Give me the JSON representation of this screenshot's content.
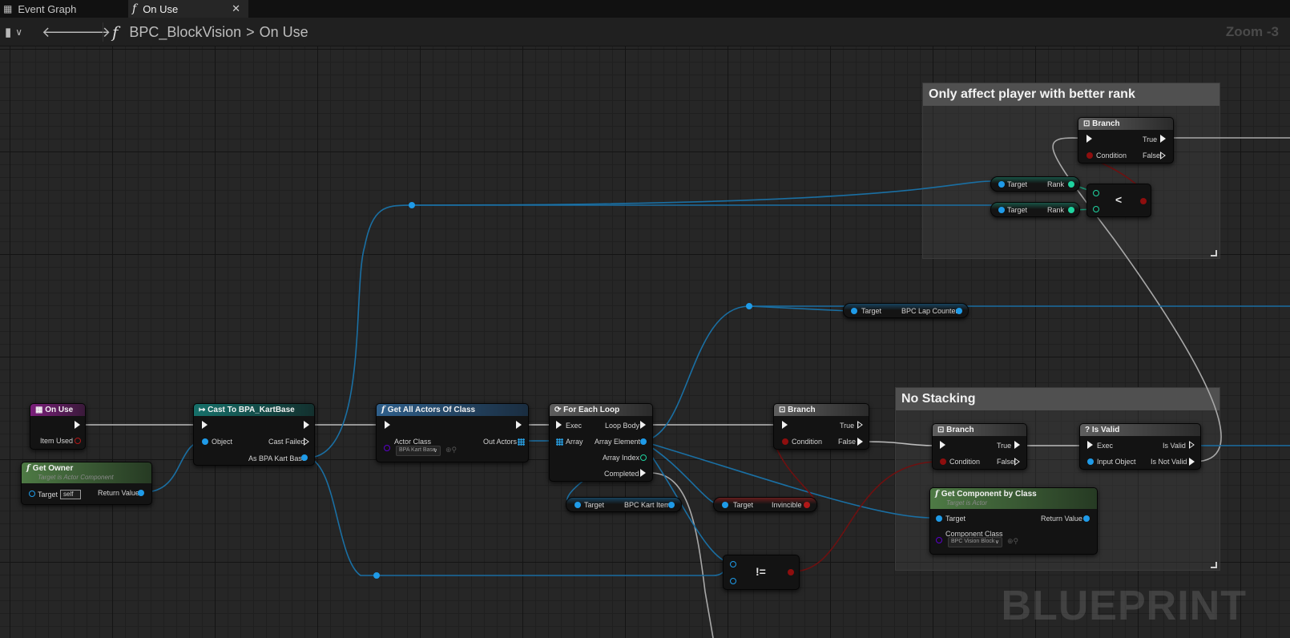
{
  "tabs": [
    {
      "label": "Event Graph",
      "active": false
    },
    {
      "label": "On Use",
      "active": true
    }
  ],
  "toolbar": {
    "breadcrumb_root": "BPC_BlockVision",
    "breadcrumb_separator": ">",
    "breadcrumb_current": "On Use",
    "zoom": "Zoom -3"
  },
  "comments": {
    "rank": "Only affect player with better rank",
    "stacking": "No Stacking"
  },
  "nodes": {
    "on_use": {
      "title": "On Use",
      "item_used": "Item Used"
    },
    "get_owner": {
      "title": "Get Owner",
      "subtitle": "Target is Actor Component",
      "target": "Target",
      "target_value": "self",
      "return_value": "Return Value"
    },
    "cast": {
      "title": "Cast To BPA_KartBase",
      "object": "Object",
      "cast_failed": "Cast Failed",
      "as_base": "As BPA Kart Base"
    },
    "get_all": {
      "title": "Get All Actors Of Class",
      "actor_class": "Actor Class",
      "class_value": "BPA Kart Base",
      "out_actors": "Out Actors"
    },
    "for_each": {
      "title": "For Each Loop",
      "exec": "Exec",
      "array": "Array",
      "loop_body": "Loop Body",
      "array_element": "Array Element",
      "array_index": "Array Index",
      "completed": "Completed"
    },
    "branch_main": {
      "title": "Branch",
      "condition": "Condition",
      "true": "True",
      "false": "False"
    },
    "branch_stack": {
      "title": "Branch",
      "condition": "Condition",
      "true": "True",
      "false": "False"
    },
    "is_valid": {
      "title": "Is Valid",
      "exec": "Exec",
      "input_object": "Input Object",
      "is_valid": "Is Valid",
      "is_not_valid": "Is Not Valid"
    },
    "get_component": {
      "title": "Get Component by Class",
      "subtitle": "Target is Actor",
      "target": "Target",
      "component_class": "Component Class",
      "class_value": "BPC Vision Block",
      "return_value": "Return Value"
    },
    "branch_rank": {
      "title": "Branch",
      "condition": "Condition",
      "true": "True",
      "false": "False"
    },
    "rank_top": {
      "target": "Target",
      "out": "Rank"
    },
    "rank_bottom": {
      "target": "Target",
      "out": "Rank"
    },
    "less_than": {
      "symbol": "<"
    },
    "lap_counter": {
      "target": "Target",
      "out": "BPC Lap Counter"
    },
    "kart_item": {
      "target": "Target",
      "out": "BPC Kart Item"
    },
    "invincible": {
      "target": "Target",
      "out": "Invincible"
    },
    "not_equal": {
      "symbol": "!="
    }
  },
  "colors": {
    "exec": "#f0f0f0",
    "object_pin": "#1f9be8",
    "bool_pin": "#8e0e0e",
    "int_pin": "#1fd4a0",
    "class_pin": "#5a00c8",
    "event_header": "#7a1f7a",
    "cast_header": "#16706a",
    "function_header": "#2f5f8a",
    "pure_header": "#4e7a45",
    "flow_header": "#5e5e5e"
  },
  "icons": [
    "graph-icon",
    "function-icon",
    "close-icon",
    "bookmark-icon",
    "back-arrow-icon",
    "forward-arrow-icon",
    "branch-icon",
    "loop-icon",
    "cast-icon",
    "event-icon",
    "is-valid-icon"
  ],
  "watermark": "BLUEPRINT"
}
